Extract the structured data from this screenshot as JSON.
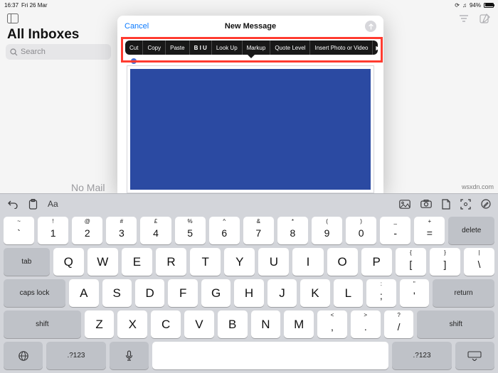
{
  "status": {
    "time": "16:37",
    "date": "Fri 26 Mar",
    "battery_pct": "94%"
  },
  "mail": {
    "title": "All Inboxes",
    "search_placeholder": "Search",
    "empty_state": "No Mail"
  },
  "compose": {
    "cancel": "Cancel",
    "title": "New Message"
  },
  "edit_menu": {
    "cut": "Cut",
    "copy": "Copy",
    "paste": "Paste",
    "biu": "B I U",
    "lookup": "Look Up",
    "markup": "Markup",
    "quote": "Quote Level",
    "insert": "Insert Photo or Video",
    "more": "▶"
  },
  "kb": {
    "aa": "Aa",
    "row1": {
      "k1": {
        "alt": "~",
        "main": "`"
      },
      "k2": {
        "alt": "!",
        "main": "1"
      },
      "k3": {
        "alt": "@",
        "main": "2"
      },
      "k4": {
        "alt": "#",
        "main": "3"
      },
      "k5": {
        "alt": "£",
        "main": "4"
      },
      "k6": {
        "alt": "%",
        "main": "5"
      },
      "k7": {
        "alt": "^",
        "main": "6"
      },
      "k8": {
        "alt": "&",
        "main": "7"
      },
      "k9": {
        "alt": "*",
        "main": "8"
      },
      "k10": {
        "alt": "(",
        "main": "9"
      },
      "k11": {
        "alt": ")",
        "main": "0"
      },
      "k12": {
        "alt": "_",
        "main": "-"
      },
      "k13": {
        "alt": "+",
        "main": "="
      },
      "delete": "delete"
    },
    "row2": {
      "tab": "tab",
      "q": "Q",
      "w": "W",
      "e": "E",
      "r": "R",
      "t": "T",
      "y": "Y",
      "u": "U",
      "i": "I",
      "o": "O",
      "p": "P",
      "br1": {
        "alt": "{",
        "main": "["
      },
      "br2": {
        "alt": "}",
        "main": "]"
      },
      "bs": {
        "alt": "|",
        "main": "\\"
      }
    },
    "row3": {
      "caps": "caps lock",
      "a": "A",
      "s": "S",
      "d": "D",
      "f": "F",
      "g": "G",
      "h": "H",
      "j": "J",
      "k": "K",
      "l": "L",
      "sc": {
        "alt": ":",
        "main": ";"
      },
      "qt": {
        "alt": "\"",
        "main": "'"
      },
      "return": "return"
    },
    "row4": {
      "shiftL": "shift",
      "z": "Z",
      "x": "X",
      "c": "C",
      "v": "V",
      "b": "B",
      "n": "N",
      "m": "M",
      "cm": {
        "alt": "<",
        "main": ","
      },
      "pd": {
        "alt": ">",
        "main": "."
      },
      "sl": {
        "alt": "?",
        "main": "/"
      },
      "shiftR": "shift"
    },
    "row5": {
      "numL": ".?123",
      "numR": ".?123"
    }
  },
  "watermark": "wsxdn.com"
}
